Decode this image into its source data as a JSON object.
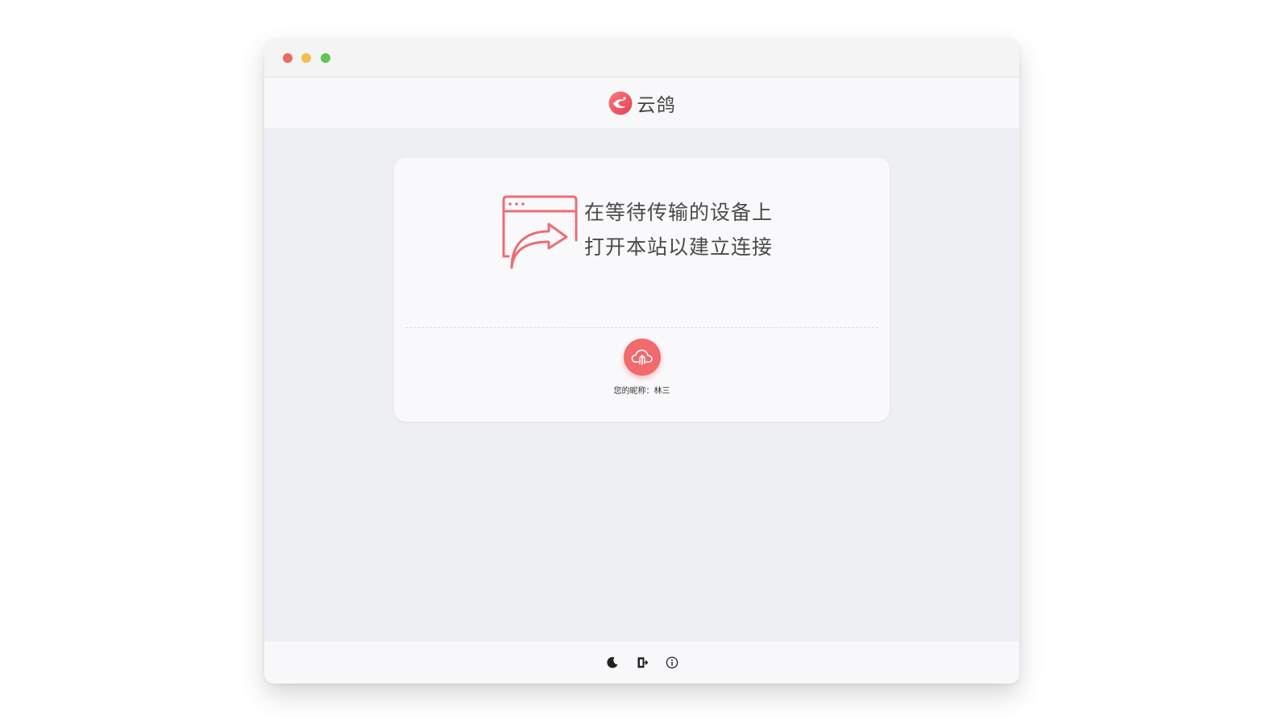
{
  "window": {
    "controls": [
      "close",
      "minimize",
      "maximize"
    ]
  },
  "header": {
    "app_name": "云鸽",
    "logo_icon": "dove-logo-icon",
    "accent_color": "#f06a6e"
  },
  "card": {
    "hint_icon": "browser-share-icon",
    "hint_lines": [
      "在等待传输的设备上",
      "打开本站以建立连接"
    ],
    "user_icon": "cloud-upload-icon",
    "nickname_label": "您的昵称：",
    "nickname_value": "林三"
  },
  "footer": {
    "buttons": [
      {
        "icon": "moon-icon",
        "label": "theme"
      },
      {
        "icon": "exit-icon",
        "label": "exit"
      },
      {
        "icon": "info-icon",
        "label": "info"
      }
    ]
  }
}
